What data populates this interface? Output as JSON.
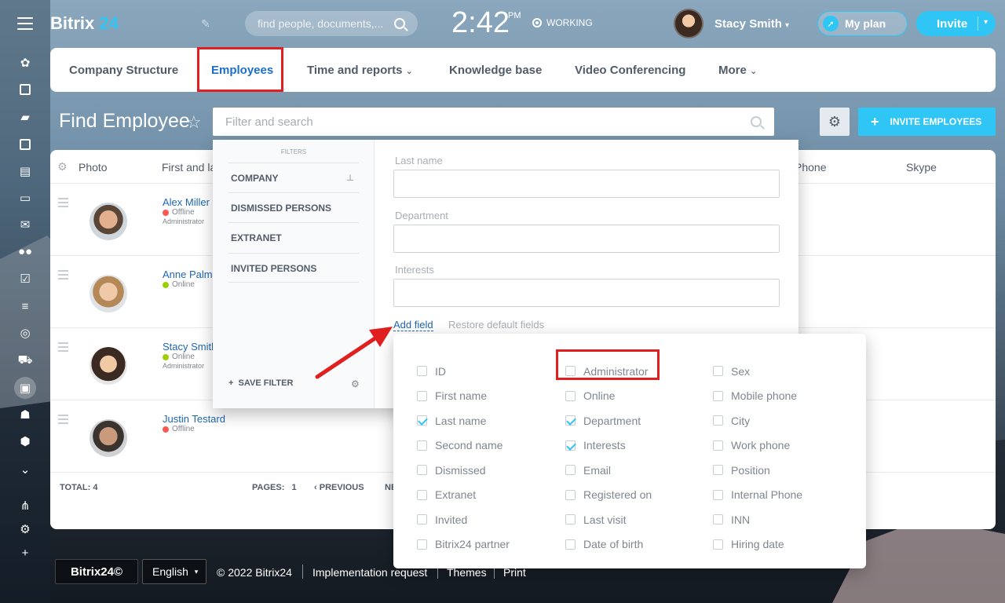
{
  "header": {
    "logo_main": "Bitrix",
    "logo_num": "24",
    "search_placeholder": "find people, documents,...",
    "time": "2:42",
    "ampm": "PM",
    "work_status": "WORKING",
    "user_name": "Stacy Smith",
    "plan_label": "My plan",
    "invite_label": "Invite"
  },
  "nav": {
    "tabs": [
      {
        "label": "Company Structure"
      },
      {
        "label": "Employees"
      },
      {
        "label": "Time and reports"
      },
      {
        "label": "Knowledge base"
      },
      {
        "label": "Video Conferencing"
      },
      {
        "label": "More"
      }
    ]
  },
  "page": {
    "title": "Find Employee",
    "filter_placeholder": "Filter and search",
    "invite_employees": "INVITE EMPLOYEES"
  },
  "grid": {
    "columns": [
      "Photo",
      "First and la",
      "Phone",
      "Skype"
    ],
    "rows": [
      {
        "name": "Alex Miller",
        "status": "Offline",
        "role": "Administrator"
      },
      {
        "name": "Anne Palme",
        "status": "Online",
        "role": ""
      },
      {
        "name": "Stacy Smith",
        "status": "Online",
        "role": "Administrator"
      },
      {
        "name": "Justin Testard",
        "status": "Offline",
        "role": ""
      }
    ],
    "total_label": "TOTAL:",
    "total": "4",
    "pages_label": "PAGES:",
    "page": "1",
    "previous": "PREVIOUS",
    "next": "NE"
  },
  "filter_popup": {
    "title": "FILTERS",
    "presets": [
      "COMPANY",
      "DISMISSED PERSONS",
      "EXTRANET",
      "INVITED PERSONS"
    ],
    "save_filter": "SAVE FILTER",
    "fields": [
      {
        "label": "Last name"
      },
      {
        "label": "Department"
      },
      {
        "label": "Interests"
      }
    ],
    "add_field": "Add field",
    "restore": "Restore default fields"
  },
  "field_options": {
    "col1": [
      {
        "label": "ID",
        "checked": false
      },
      {
        "label": "First name",
        "checked": false
      },
      {
        "label": "Last name",
        "checked": true
      },
      {
        "label": "Second name",
        "checked": false
      },
      {
        "label": "Dismissed",
        "checked": false
      },
      {
        "label": "Extranet",
        "checked": false
      },
      {
        "label": "Invited",
        "checked": false
      },
      {
        "label": "Bitrix24 partner",
        "checked": false
      }
    ],
    "col2": [
      {
        "label": "Administrator",
        "checked": false
      },
      {
        "label": "Online",
        "checked": false
      },
      {
        "label": "Department",
        "checked": true
      },
      {
        "label": "Interests",
        "checked": true
      },
      {
        "label": "Email",
        "checked": false
      },
      {
        "label": "Registered on",
        "checked": false
      },
      {
        "label": "Last visit",
        "checked": false
      },
      {
        "label": "Date of birth",
        "checked": false
      }
    ],
    "col3": [
      {
        "label": "Sex",
        "checked": false
      },
      {
        "label": "Mobile phone",
        "checked": false
      },
      {
        "label": "City",
        "checked": false
      },
      {
        "label": "Work phone",
        "checked": false
      },
      {
        "label": "Position",
        "checked": false
      },
      {
        "label": "Internal Phone",
        "checked": false
      },
      {
        "label": "INN",
        "checked": false
      },
      {
        "label": "Hiring date",
        "checked": false
      }
    ]
  },
  "footer": {
    "logo": "Bitrix24©",
    "language": "English",
    "copyright": "© 2022 Bitrix24",
    "links": [
      "Implementation request",
      "Themes",
      "Print"
    ]
  },
  "colors": {
    "accent": "#2fc6f6",
    "link": "#2067b0",
    "highlight": "#e02020",
    "online": "#9dcf00",
    "offline": "#ff5752"
  }
}
